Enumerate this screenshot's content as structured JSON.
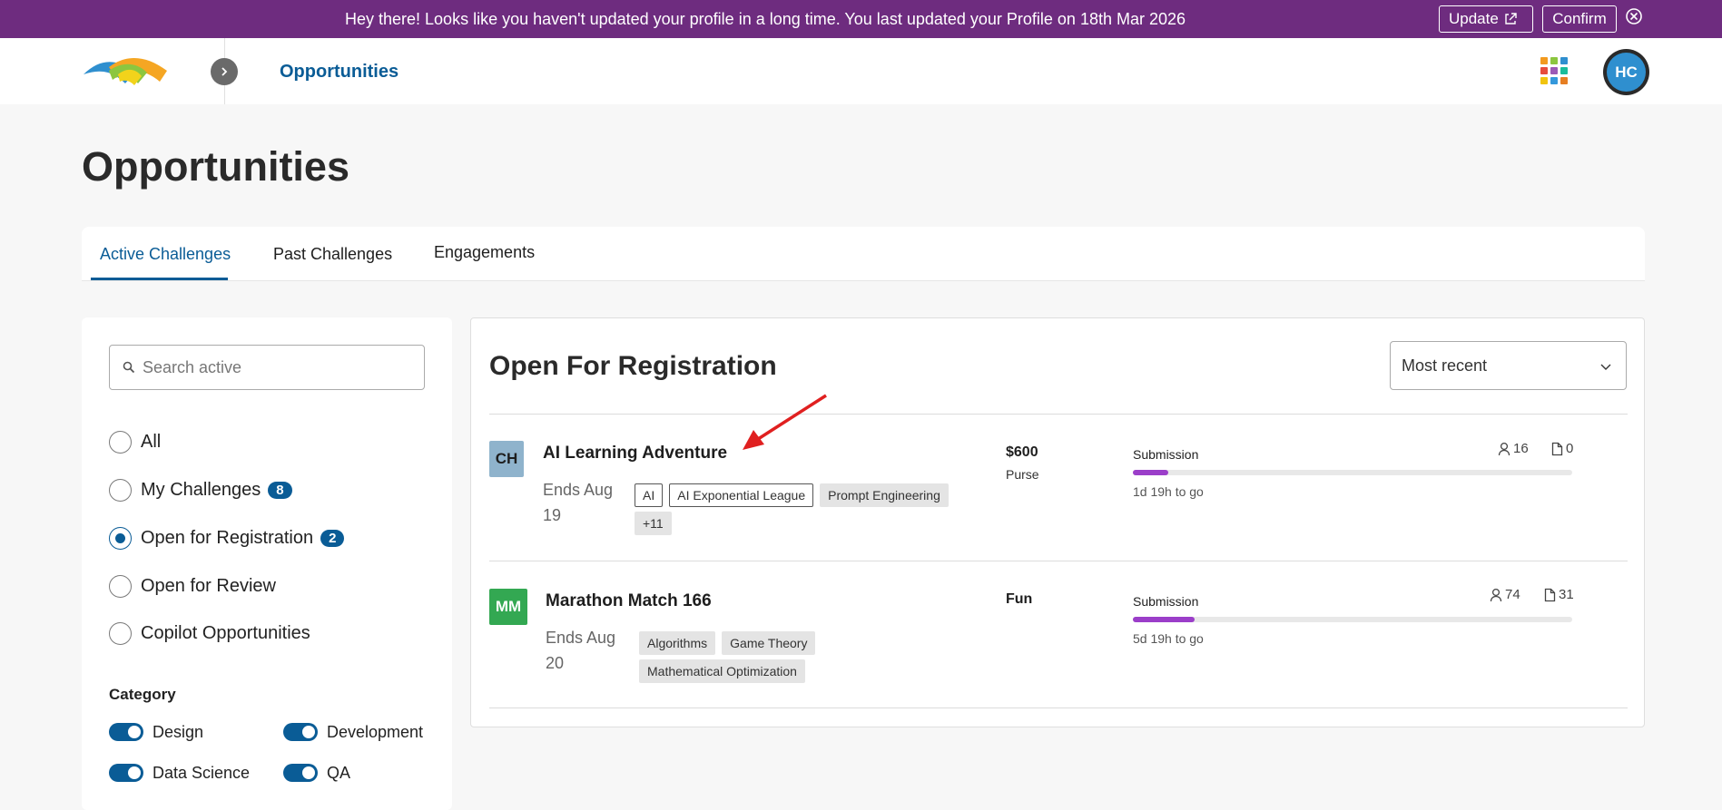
{
  "banner": {
    "message": "Hey there! Looks like you haven't updated your profile in a long time. You last updated your Profile on 18th Mar 2026",
    "update_label": "Update",
    "confirm_label": "Confirm"
  },
  "header": {
    "title": "Opportunities",
    "avatar_initials": "HC",
    "apps_colors": [
      "#f29a1f",
      "#8cc63f",
      "#2f8fcf",
      "#e74c3c",
      "#9b59b6",
      "#1abc9c",
      "#f1c40f",
      "#3498db",
      "#e67e22"
    ]
  },
  "page": {
    "title": "Opportunities"
  },
  "tabs": [
    {
      "label": "Active Challenges",
      "active": true
    },
    {
      "label": "Past Challenges",
      "active": false
    },
    {
      "label": "Engagements",
      "active": false
    }
  ],
  "sidebar": {
    "search_placeholder": "Search active",
    "filters": [
      {
        "label": "All",
        "count": null,
        "checked": false
      },
      {
        "label": "My Challenges",
        "count": "8",
        "checked": false
      },
      {
        "label": "Open for Registration",
        "count": "2",
        "checked": true
      },
      {
        "label": "Open for Review",
        "count": null,
        "checked": false
      },
      {
        "label": "Copilot Opportunities",
        "count": null,
        "checked": false
      }
    ],
    "category_title": "Category",
    "categories": [
      {
        "label": "Design",
        "on": true
      },
      {
        "label": "Development",
        "on": true
      },
      {
        "label": "Data Science",
        "on": true
      },
      {
        "label": "QA",
        "on": true
      }
    ]
  },
  "main": {
    "section_title": "Open For Registration",
    "sort_value": "Most recent",
    "challenges": [
      {
        "initials": "CH",
        "badge_color": "#8fb3cc",
        "title": "AI Learning Adventure",
        "ends_line1": "Ends Aug",
        "ends_line2": "19",
        "tags": [
          "AI",
          "AI Exponential League",
          "Prompt Engineering",
          "+11"
        ],
        "prize": "$600",
        "prize_sub": "Purse",
        "phase": "Submission",
        "progress": 0.08,
        "time_left": "1d 19h to go",
        "registrants": "16",
        "submissions": "0"
      },
      {
        "initials": "MM",
        "badge_color": "#33a852",
        "title": "Marathon Match 166",
        "ends_line1": "Ends Aug",
        "ends_line2": "20",
        "tags": [
          "Algorithms",
          "Game Theory",
          "Mathematical Optimization"
        ],
        "prize": "Fun",
        "prize_sub": "",
        "phase": "Submission",
        "progress": 0.14,
        "time_left": "5d 19h to go",
        "registrants": "74",
        "submissions": "31"
      }
    ]
  },
  "colors": {
    "banner_bg": "#6e2c7f",
    "accent": "#0a5c96",
    "progress": "#9b3ec9",
    "annotation_arrow": "#e02020"
  }
}
